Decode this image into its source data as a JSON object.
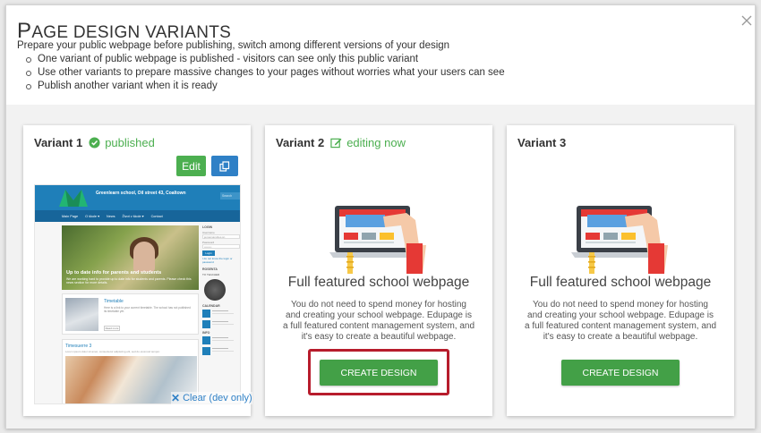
{
  "dialog": {
    "title_cap": "P",
    "title_rest": "AGE DESIGN VARIANTS",
    "intro": "Prepare your public webpage before publishing, switch among different versions of your design",
    "bullets": [
      "One variant of public webpage is published - visitors can see only this public variant",
      "Use other variants to prepare massive changes to your pages without worries what your users can see",
      "Publish another variant when it is ready"
    ],
    "close_icon": "close-icon"
  },
  "variants": [
    {
      "name": "Variant 1",
      "state": "published",
      "state_icon": "globe-check-icon",
      "edit_label": "Edit",
      "copy_icon": "copy-icon",
      "clear_label": "Clear (dev only)",
      "preview": {
        "school_name": "Greenlearn school, Oil street 43, Coaltown",
        "search_placeholder": "Search",
        "nav": [
          "Main Page",
          "O škole ▾",
          "News",
          "Život v škole ▾",
          "Contact"
        ],
        "hero_title": "Up to date info for parents and students",
        "hero_sub": "We are working hard to provide up to date info for students and parents. Please check this news section for more details.",
        "box_title": "Timetable",
        "box_text": "Here is a link to your current timetable. The school has not published its timetable yet.",
        "box_button": "Read more",
        "box2_title": "Timesuerre 3",
        "box2_text": "Lorem ipsum dolor sit amet, consectetur adipiscing elit, sed do eiusmod tempor.",
        "side_login": "LOGIN",
        "side_username_label": "Username",
        "side_username": "jensamanultes.sn",
        "side_password_label": "Password",
        "side_password": "••••••••",
        "side_login_btn": "Login",
        "side_forgot": "I do not know the login or password",
        "side_rosenta": "ROSENTA",
        "side_teachers": "TO TEACHER",
        "side_calendar": "CALENDAR",
        "side_info": "INFO"
      }
    },
    {
      "name": "Variant 2",
      "state": "editing now",
      "state_icon": "edit-icon",
      "title": "Full featured school webpage",
      "description": "You do not need to spend money for hosting and creating your school webpage. Edupage is a full featured content management system, and it's easy to create a beautiful webpage.",
      "button": "CREATE DESIGN"
    },
    {
      "name": "Variant 3",
      "title": "Full featured school webpage",
      "description": "You do not need to spend money for hosting and creating your school webpage. Edupage is a full featured content management system, and it's easy to create a beautiful webpage.",
      "button": "CREATE DESIGN"
    }
  ],
  "colors": {
    "green": "#4caf50",
    "blue": "#2f80c6",
    "highlight": "#b71c2c"
  }
}
